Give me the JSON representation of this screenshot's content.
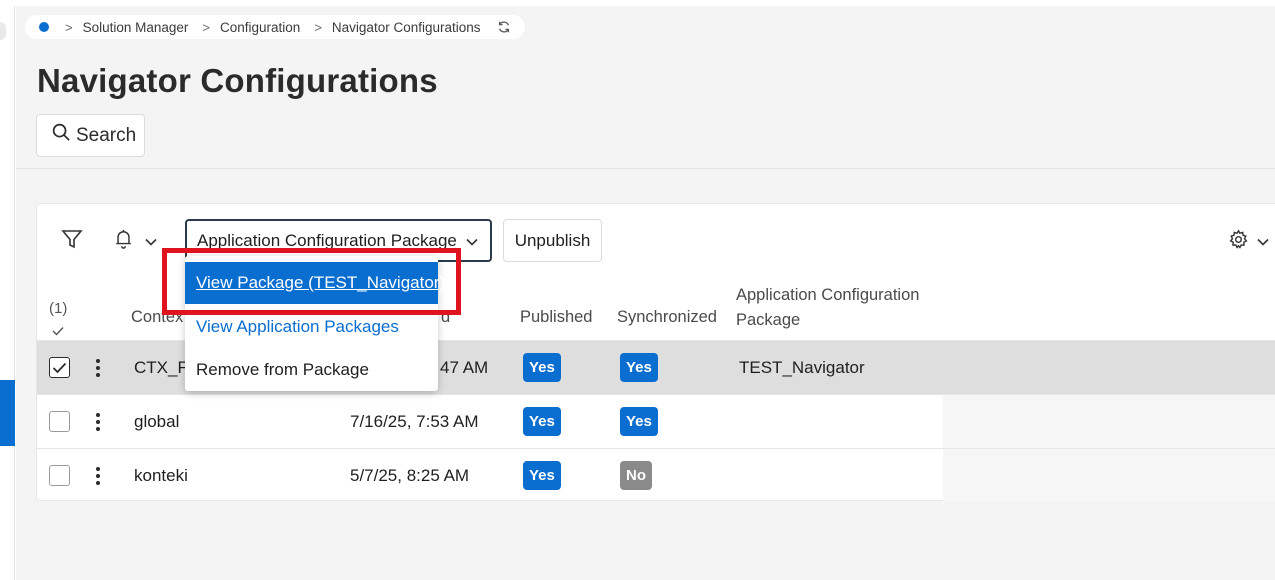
{
  "breadcrumb": {
    "items": [
      "Solution Manager",
      "Configuration",
      "Navigator Configurations"
    ]
  },
  "page": {
    "title": "Navigator Configurations",
    "search_label": "Search"
  },
  "toolbar": {
    "package_dropdown_label": "Application Configuration Package",
    "unpublish_label": "Unpublish"
  },
  "table": {
    "selected_count": "(1)",
    "columns": {
      "context": "Contex",
      "modified": "d",
      "published": "Published",
      "synchronized": "Synchronized",
      "package_line1": "Application Configuration",
      "package_line2": "Package"
    },
    "rows": [
      {
        "context": "CTX_FR",
        "modified": "47 AM",
        "published": "Yes",
        "synchronized": "Yes",
        "package": "TEST_Navigator",
        "selected": true
      },
      {
        "context": "global",
        "modified": "7/16/25, 7:53 AM",
        "published": "Yes",
        "synchronized": "Yes",
        "package": "",
        "selected": false
      },
      {
        "context": "konteki",
        "modified": "5/7/25, 8:25 AM",
        "published": "Yes",
        "synchronized": "No",
        "package": "",
        "selected": false
      }
    ]
  },
  "dropdown_menu": {
    "items": [
      "View Package (TEST_Navigator)",
      "View Application Packages",
      "Remove from Package"
    ]
  },
  "colors": {
    "accent": "#0a6ed1",
    "badge_yes": "#0a6ed1",
    "badge_no": "#8a8a8a",
    "highlight": "#e0141e"
  }
}
